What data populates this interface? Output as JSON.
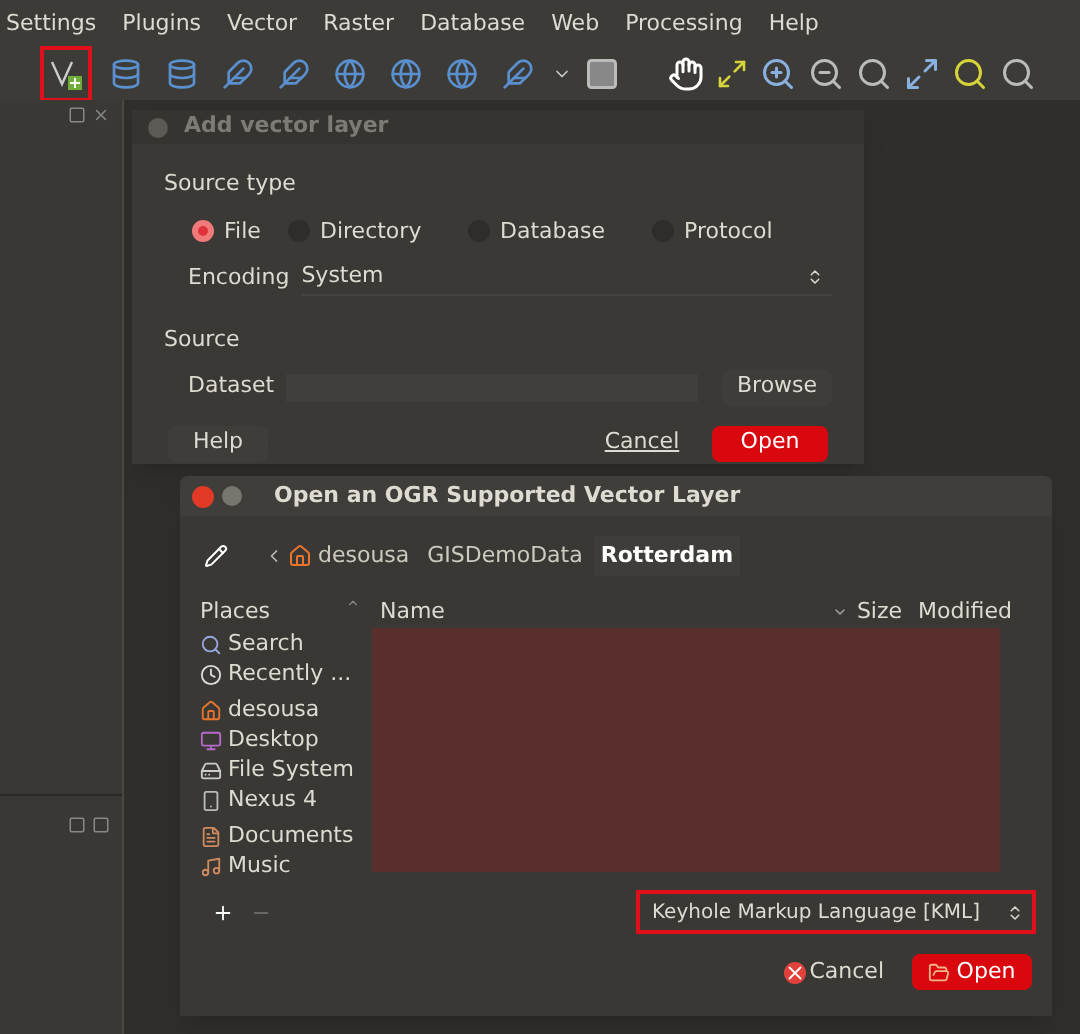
{
  "menu_bar": {
    "items": [
      "Settings",
      "Plugins",
      "Vector",
      "Raster",
      "Database",
      "Web",
      "Processing",
      "Help"
    ]
  },
  "toolbar": {
    "add_vector_highlighted": true
  },
  "add_vector_dialog": {
    "title": "Add vector layer",
    "source_type_label": "Source type",
    "source_types": [
      {
        "label": "File",
        "selected": true
      },
      {
        "label": "Directory",
        "selected": false
      },
      {
        "label": "Database",
        "selected": false
      },
      {
        "label": "Protocol",
        "selected": false
      }
    ],
    "encoding_label": "Encoding",
    "encoding_value": "System",
    "source_label": "Source",
    "dataset_label": "Dataset",
    "browse_button": "Browse",
    "help_button": "Help",
    "cancel_button": "Cancel",
    "open_button": "Open"
  },
  "file_dialog": {
    "title": "Open an OGR Supported Vector Layer",
    "breadcrumbs": [
      {
        "label": "desousa",
        "selected": false
      },
      {
        "label": "GISDemoData",
        "selected": false
      },
      {
        "label": "Rotterdam",
        "selected": true
      }
    ],
    "places_header": "Places",
    "places": [
      {
        "label": "Search",
        "kind": "search"
      },
      {
        "label": "Recently ...",
        "kind": "recent"
      },
      {
        "label": "desousa",
        "kind": "home"
      },
      {
        "label": "Desktop",
        "kind": "desktop"
      },
      {
        "label": "File System",
        "kind": "drive"
      },
      {
        "label": "Nexus 4",
        "kind": "device"
      },
      {
        "label": "Documents",
        "kind": "documents"
      },
      {
        "label": "Music",
        "kind": "music"
      }
    ],
    "columns": [
      "Name",
      "Size",
      "Modified"
    ],
    "filter": {
      "value": "Keyhole Markup Language [KML]",
      "highlighted": true
    },
    "cancel_button": "Cancel",
    "open_button": "Open"
  }
}
